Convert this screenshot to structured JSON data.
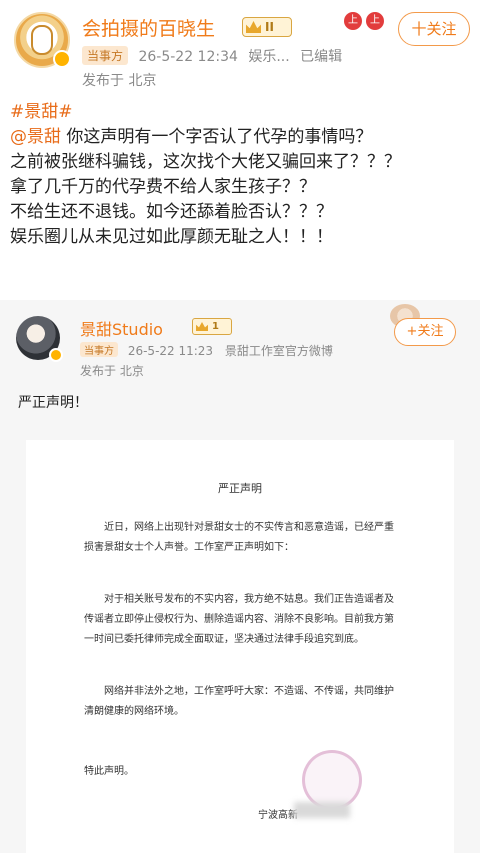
{
  "post": {
    "author": "会拍摄的百晓生",
    "vip_level": "II",
    "follow_label": "十关注",
    "deco_badges": [
      "上",
      "上"
    ],
    "tag": "当事方",
    "timestamp": "26-5-22 12:34",
    "source": "娱乐...",
    "edited": "已编辑",
    "location": "发布于 北京",
    "hashtag": "#景甜#",
    "mention": "@景甜",
    "lines": [
      " 你这声明有一个字否认了代孕的事情吗？",
      "之前被张继科骗钱，这次找个大佬又骗回来了？？？",
      "拿了几千万的代孕费不给人家生孩子？？",
      "不给生还不退钱。如今还舔着脸否认？？？",
      "娱乐圈儿从未见过如此厚颜无耻之人！！！"
    ]
  },
  "quoted": {
    "author": "景甜Studio",
    "vip_level": "1",
    "follow_label": "+关注",
    "tag": "当事方",
    "timestamp": "26-5-22 11:23",
    "source": "景甜工作室官方微博",
    "location": "发布于 北京",
    "text": "严正声明！"
  },
  "statement": {
    "title": "严正声明",
    "paragraphs": [
      "近日，网络上出现针对景甜女士的不实传言和恶意造谣，已经严重损害景甜女士个人声誉。工作室严正声明如下：",
      "对于相关账号发布的不实内容，我方绝不姑息。我们正告造谣者及传谣者立即停止侵权行为、删除造谣内容、消除不良影响。目前我方第一时间已委托律师完成全面取证，坚决通过法律手段追究到底。",
      "网络并非法外之地，工作室呼吁大家：不造谣、不传谣，共同维护清朗健康的网络环境。"
    ],
    "ending": "特此声明。",
    "signature": "宁波高新"
  },
  "colors": {
    "accent": "#f07b1a",
    "tag_bg": "#fce7cf",
    "quoted_bg": "#f6f6f6"
  }
}
